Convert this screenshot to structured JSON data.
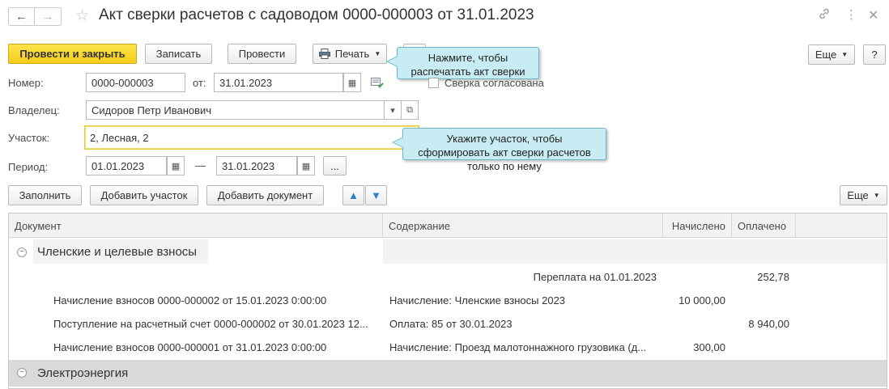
{
  "window": {
    "title": "Акт сверки расчетов с садоводом 0000-000003 от 31.01.2023"
  },
  "toolbar": {
    "post_and_close": "Провести и закрыть",
    "save": "Записать",
    "post": "Провести",
    "print": "Печать",
    "more": "Еще",
    "help": "?"
  },
  "tips": {
    "print_tip": "Нажмите, чтобы распечатать акт сверки",
    "plot_tip": "Укажите участок, чтобы сформировать акт сверки расчетов только по нему"
  },
  "form": {
    "number_label": "Номер:",
    "number_value": "0000-000003",
    "date_label": "от:",
    "date_value": "31.01.2023",
    "agreed_label": "Сверка согласована",
    "owner_label": "Владелец:",
    "owner_value": "Сидоров Петр Иванович",
    "plot_label": "Участок:",
    "plot_value": "2, Лесная, 2",
    "period_label": "Период:",
    "period_from": "01.01.2023",
    "period_dash": "—",
    "period_to": "31.01.2023",
    "period_more": "..."
  },
  "table_toolbar": {
    "fill": "Заполнить",
    "add_plot": "Добавить участок",
    "add_document": "Добавить документ",
    "more": "Еще"
  },
  "table": {
    "columns": [
      "Документ",
      "Содержание",
      "Начислено",
      "Оплачено"
    ],
    "groups": [
      {
        "name": "Членские и целевые взносы"
      },
      {
        "name": "Электроэнергия"
      }
    ],
    "overpay": {
      "label": "Переплата на 01.01.2023",
      "paid": "252,78"
    },
    "rows": [
      {
        "document": "Начисление взносов 0000-000002 от 15.01.2023 0:00:00",
        "content": "Начисление: Членские взносы 2023",
        "charged": "10 000,00",
        "paid": ""
      },
      {
        "document": "Поступление на расчетный счет 0000-000002 от 30.01.2023 12...",
        "content": "Оплата: 85 от 30.01.2023",
        "charged": "",
        "paid": "8 940,00"
      },
      {
        "document": "Начисление взносов 0000-000001 от 31.01.2023 0:00:00",
        "content": "Начисление: Проезд малотоннажного грузовика (д...",
        "charged": "300,00",
        "paid": ""
      }
    ]
  }
}
